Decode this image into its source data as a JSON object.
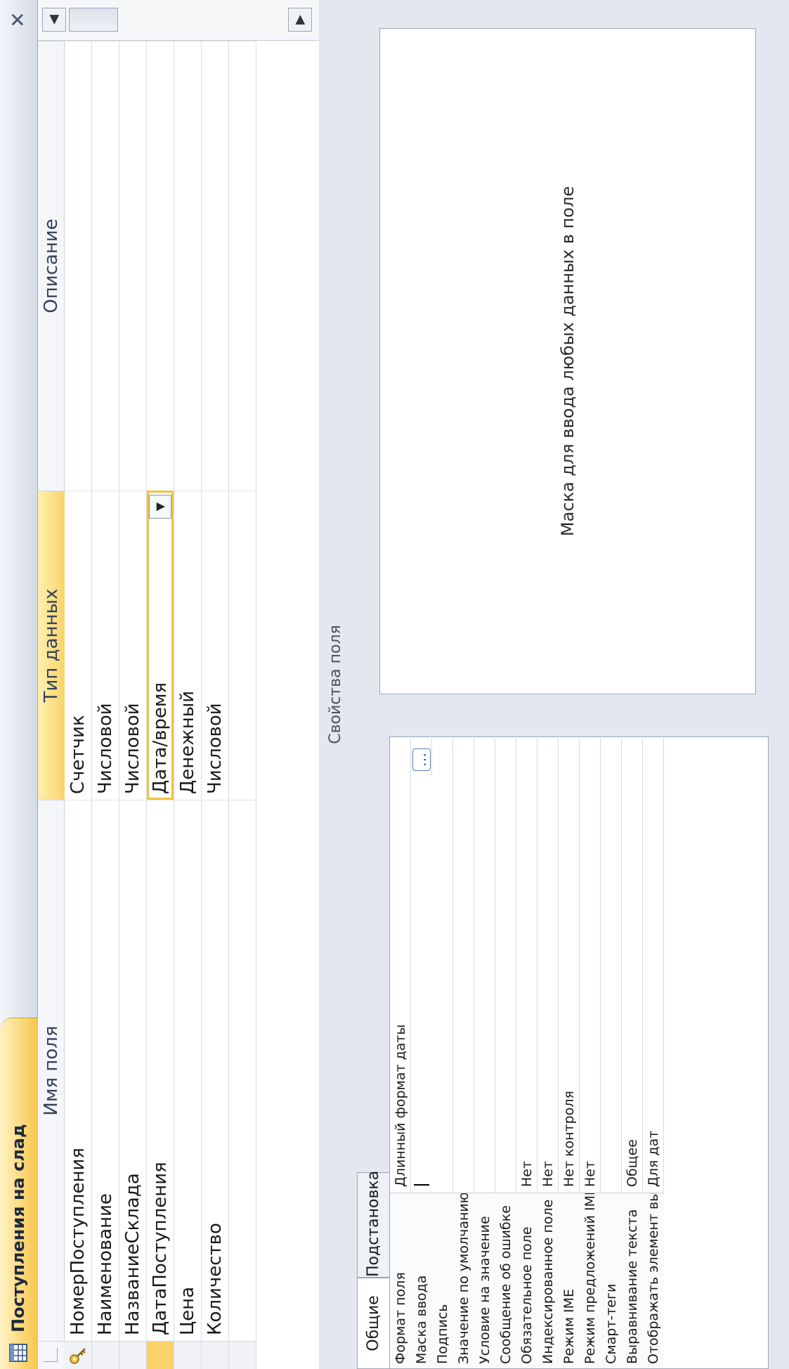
{
  "document": {
    "title": "Поступления на слад"
  },
  "grid": {
    "headers": [
      "Имя поля",
      "Тип данных",
      "Описание"
    ],
    "rows": [
      {
        "name": "НомерПоступления",
        "type": "Счетчик",
        "description": ""
      },
      {
        "name": "Наименование",
        "type": "Числовой",
        "description": ""
      },
      {
        "name": "НазваниеСклада",
        "type": "Числовой",
        "description": ""
      },
      {
        "name": "ДатаПоступления",
        "type": "Дата/время",
        "description": ""
      },
      {
        "name": "Цена",
        "type": "Денежный",
        "description": ""
      },
      {
        "name": "Количество",
        "type": "Числовой",
        "description": ""
      },
      {
        "name": "",
        "type": "",
        "description": ""
      }
    ]
  },
  "properties": {
    "section_label": "Свойства поля",
    "tabs": [
      "Общие",
      "Подстановка"
    ],
    "rows": [
      {
        "label": "Формат поля",
        "value": "Длинный формат даты"
      },
      {
        "label": "Маска ввода",
        "value": ""
      },
      {
        "label": "Подпись",
        "value": ""
      },
      {
        "label": "Значение по умолчанию",
        "value": ""
      },
      {
        "label": "Условие на значение",
        "value": ""
      },
      {
        "label": "Сообщение об ошибке",
        "value": ""
      },
      {
        "label": "Обязательное поле",
        "value": "Нет"
      },
      {
        "label": "Индексированное поле",
        "value": "Нет"
      },
      {
        "label": "Режим IME",
        "value": "Нет контроля"
      },
      {
        "label": "Режим предложений IME",
        "value": "Нет"
      },
      {
        "label": "Смарт-теги",
        "value": ""
      },
      {
        "label": "Выравнивание текста",
        "value": "Общее"
      },
      {
        "label": "Отображать элемент выбо",
        "value": "Для дат"
      }
    ],
    "help_text": "Маска для ввода любых данных в поле"
  },
  "icons": {
    "close": "close-icon",
    "table": "table-icon",
    "key": "primary-key-icon",
    "builder": "builder-ellipsis-icon"
  },
  "colors": {
    "accent": "#f9d36a",
    "chrome": "#e3e8f0"
  }
}
